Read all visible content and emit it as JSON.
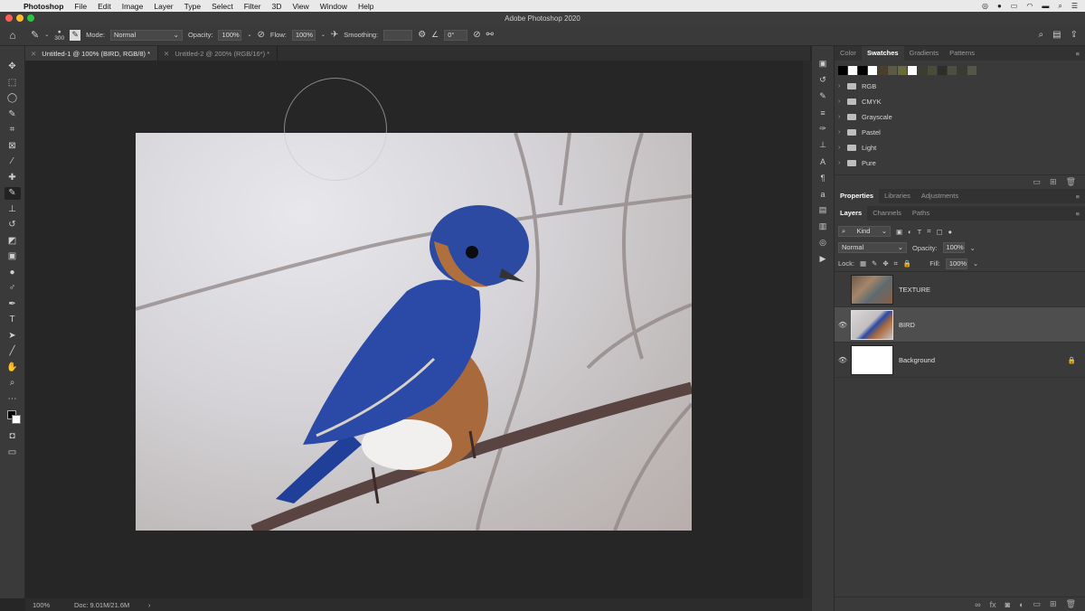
{
  "menubar": {
    "app": "Photoshop",
    "items": [
      "File",
      "Edit",
      "Image",
      "Layer",
      "Type",
      "Select",
      "Filter",
      "3D",
      "View",
      "Window",
      "Help"
    ]
  },
  "window": {
    "title": "Adobe Photoshop 2020"
  },
  "options": {
    "brush_size": "300",
    "mode_label": "Mode:",
    "mode_value": "Normal",
    "opacity_label": "Opacity:",
    "opacity_value": "100%",
    "flow_label": "Flow:",
    "flow_value": "100%",
    "smoothing_label": "Smoothing:",
    "angle_value": "0°"
  },
  "tabs": [
    {
      "label": "Untitled-1 @ 100% (BIRD, RGB/8) *"
    },
    {
      "label": "Untitled-2 @ 200% (RGB/16*) *"
    }
  ],
  "status": {
    "zoom": "100%",
    "doc": "Doc: 9.01M/21.6M",
    "arrow": "›"
  },
  "swatch_panel": {
    "tabs": [
      "Color",
      "Swatches",
      "Gradients",
      "Patterns"
    ],
    "colors": [
      "#000000",
      "#ffffff",
      "#000000",
      "#ffffff",
      "#4a3f2a",
      "#5a5a46",
      "#6b6b3a",
      "#ffffff",
      "#3c3c30",
      "#4b4b3a",
      "#2e2e28",
      "#4d4d42",
      "#3a3a32",
      "#555548"
    ],
    "folders": [
      "RGB",
      "CMYK",
      "Grayscale",
      "Pastel",
      "Light",
      "Pure"
    ]
  },
  "props_panel": {
    "tabs": [
      "Properties",
      "Libraries",
      "Adjustments"
    ]
  },
  "layers_panel": {
    "tabs": [
      "Layers",
      "Channels",
      "Paths"
    ],
    "kind": "Kind",
    "blend": "Normal",
    "opacity_label": "Opacity:",
    "opacity_value": "100%",
    "lock_label": "Lock:",
    "fill_label": "Fill:",
    "fill_value": "100%",
    "layers": [
      {
        "name": "TEXTURE"
      },
      {
        "name": "BIRD"
      },
      {
        "name": "Background"
      }
    ]
  }
}
